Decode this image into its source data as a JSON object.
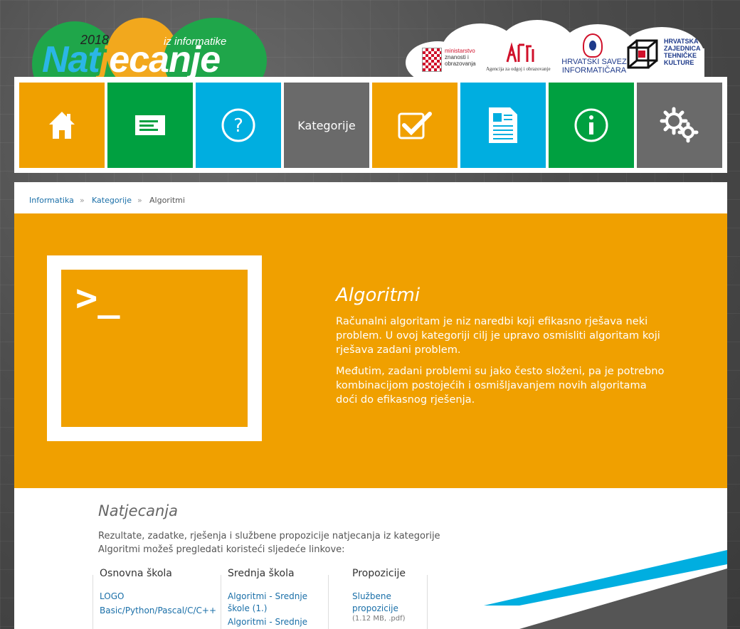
{
  "logo": {
    "year": "2018",
    "subtitle": "iz informatike",
    "main_part1": "Nat",
    "main_part2": "j",
    "main_part3": "ecanje"
  },
  "partners": {
    "ministry": {
      "line1": "ministarstvo",
      "line2": "znanosti i",
      "line3": "obrazovanja"
    },
    "azoo": {
      "mark": "azoo",
      "text": "Agencija za odgoj i obrazovanje"
    },
    "hsin": {
      "line1": "HRVATSKI SAVEZ",
      "line2": "INFORMATIČARA"
    },
    "hztk": {
      "line1": "HRVATSKA",
      "line2": "ZAJEDNICA",
      "line3": "TEHNIČKE",
      "line4": "KULTURE"
    }
  },
  "nav": {
    "tiles": [
      {
        "icon": "home-icon",
        "color": "#f0a000"
      },
      {
        "icon": "news-icon",
        "color": "#00a040"
      },
      {
        "icon": "question-icon",
        "color": "#00aee0"
      },
      {
        "label": "Kategorije",
        "color": "#6a6a6a"
      },
      {
        "icon": "checkmark-icon",
        "color": "#f0a000"
      },
      {
        "icon": "document-icon",
        "color": "#00aee0"
      },
      {
        "icon": "info-icon",
        "color": "#00a040"
      },
      {
        "icon": "gears-icon",
        "color": "#6a6a6a"
      }
    ]
  },
  "breadcrumb": {
    "item1": "Informatika",
    "sep": "»",
    "item2": "Kategorije",
    "current": "Algoritmi"
  },
  "hero": {
    "prompt": ">_",
    "title": "Algoritmi",
    "p1": "Računalni algoritam je niz naredbi koji efikasno rješava neki problem. U ovoj kategoriji cilj je upravo osmisliti algoritam koji rješava zadani problem.",
    "p2": "Međutim, zadani problemi su jako često složeni, pa je potrebno kombinacijom postojećih i osmišljavanjem novih algoritama doći do efikasnog rješenja."
  },
  "competitions": {
    "title": "Natjecanja",
    "intro": "Rezultate, zadatke, rješenja i službene propozicije natjecanja iz kategorije Algoritmi možeš pregledati koristeći sljedeće linkove:",
    "columns": [
      {
        "heading": "Osnovna škola",
        "links": [
          "LOGO",
          "Basic/Python/Pascal/C/C++"
        ]
      },
      {
        "heading": "Srednja škola",
        "links": [
          "Algoritmi - Srednje škole (1.)",
          "Algoritmi - Srednje škole"
        ]
      },
      {
        "heading": "Propozicije",
        "links": [
          "Službene propozicije"
        ],
        "meta": "(1.12 MB, .pdf)"
      }
    ]
  },
  "colors": {
    "orange": "#f0a000",
    "green": "#00a040",
    "blue": "#00aee0",
    "gray": "#6a6a6a",
    "link": "#1a6fa8"
  }
}
